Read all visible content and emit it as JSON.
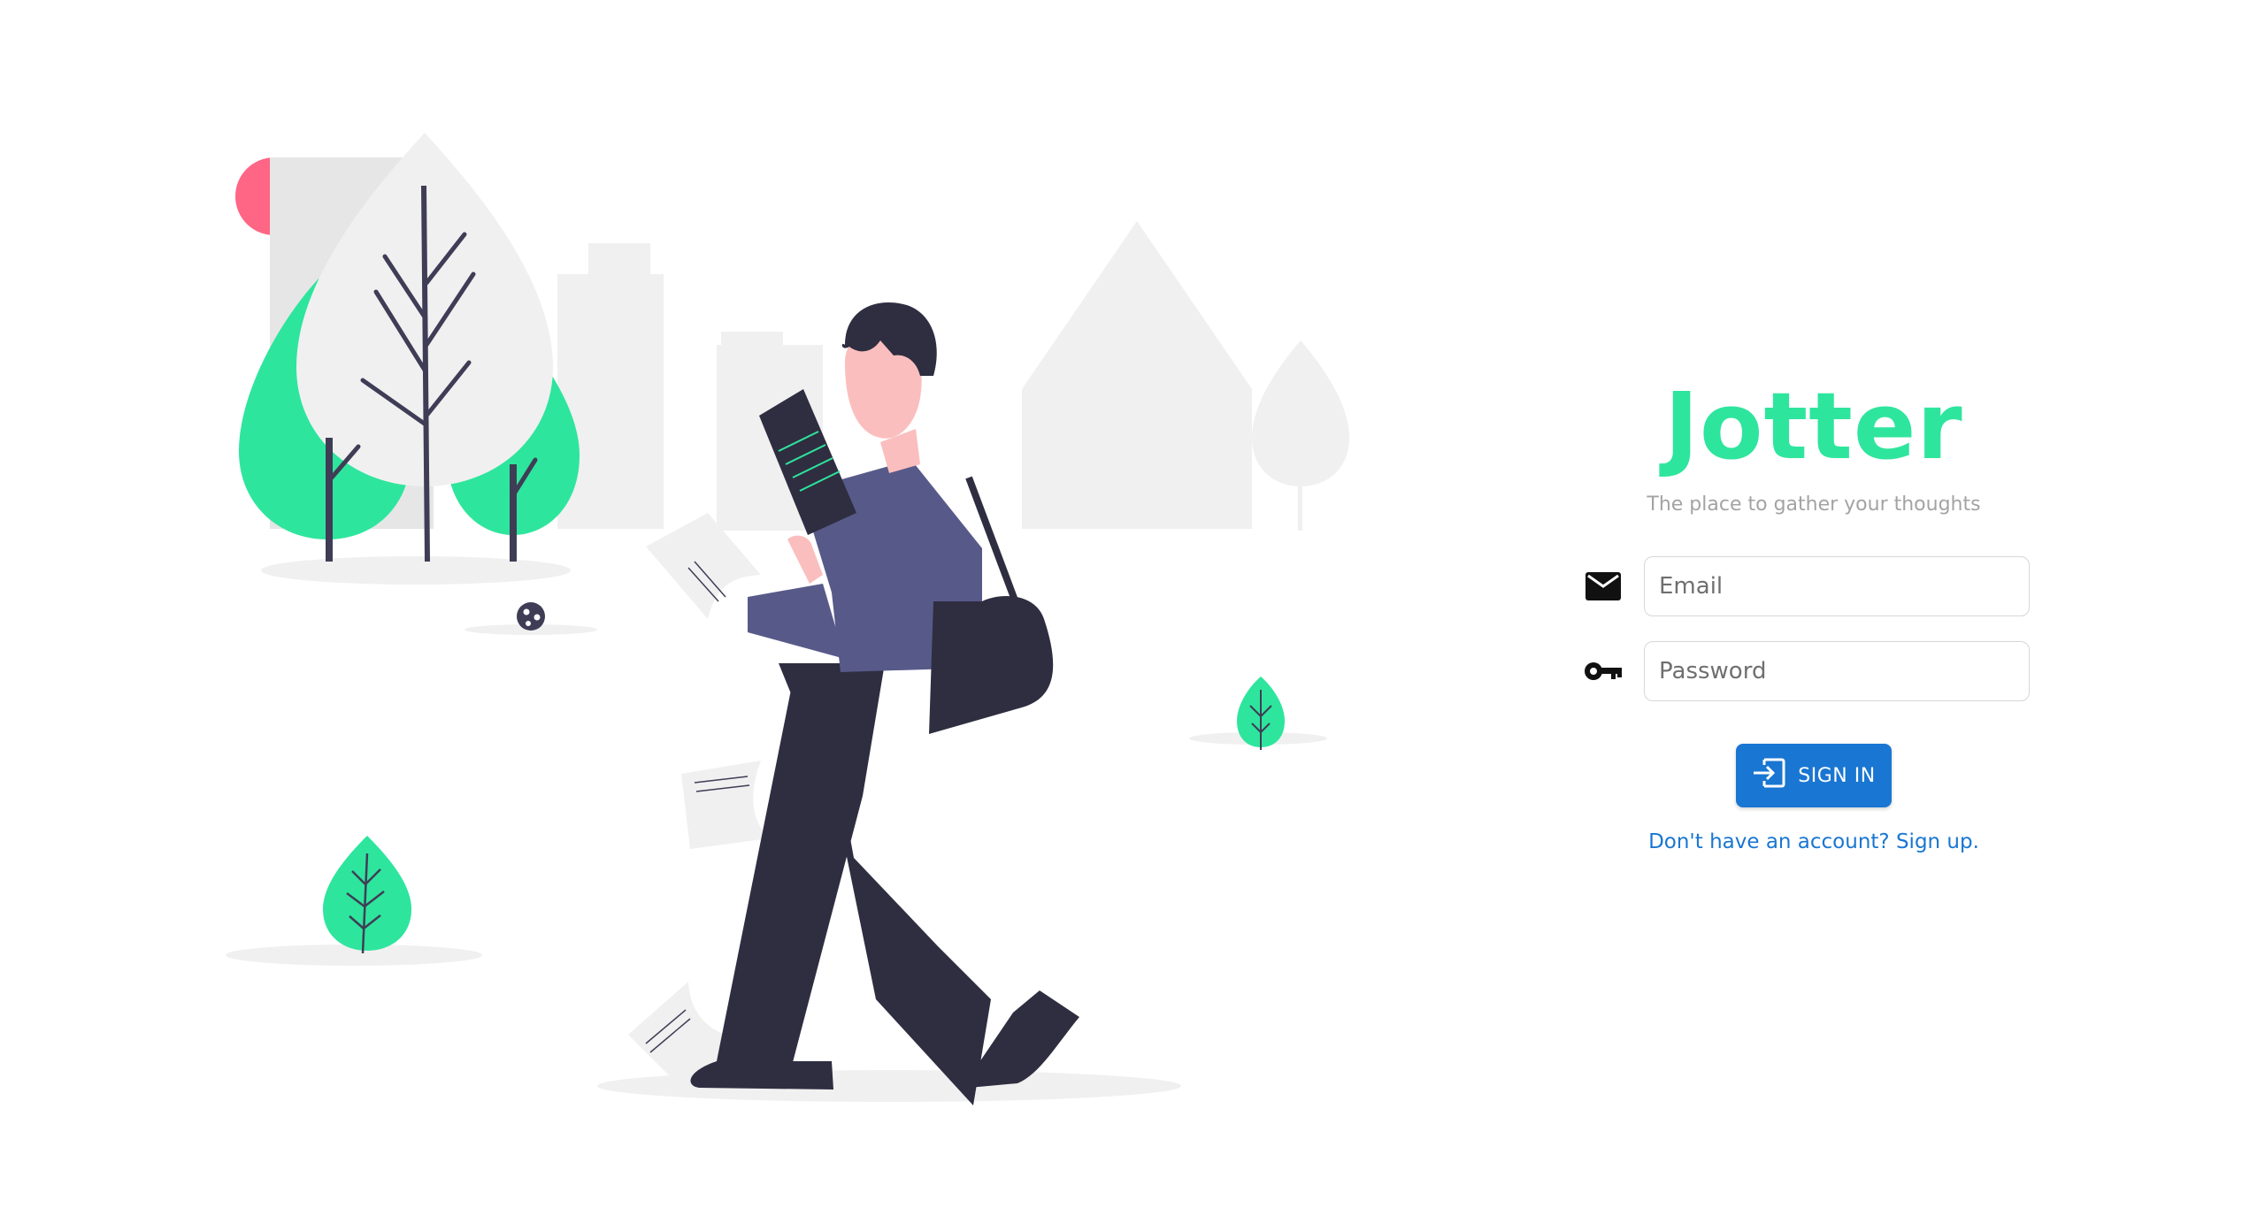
{
  "brand": {
    "title": "Jotter",
    "tagline": "The place to gather your thoughts",
    "accent_color": "#2ee59d"
  },
  "form": {
    "email": {
      "placeholder": "Email",
      "value": "",
      "icon": "envelope-icon"
    },
    "password": {
      "placeholder": "Password",
      "value": "",
      "icon": "key-icon"
    },
    "signin_label": "SIGN IN",
    "signin_icon": "login-icon",
    "signup_link": "Don't have an account? Sign up."
  },
  "colors": {
    "primary": "#1976d2",
    "figure_dark": "#2f2e41",
    "jacket": "#575a89",
    "skin": "#fbbebe",
    "tree_green": "#2ee59d",
    "light_gray": "#f0f0f0",
    "pink": "#ff6584"
  }
}
